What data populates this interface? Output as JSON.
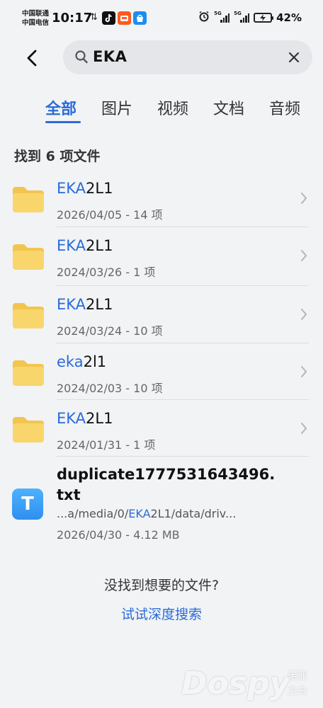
{
  "status_bar": {
    "carrier_1": "中国联通",
    "carrier_2": "中国电信",
    "time": "10:17",
    "data_arrows": "⇅",
    "network_1": "5G",
    "network_2": "5G",
    "battery_percent": "42%"
  },
  "search": {
    "query": "EKA",
    "back_icon": "chevron-left-icon",
    "search_icon": "magnifier-icon",
    "clear_icon": "close-icon"
  },
  "tabs": [
    {
      "label": "全部",
      "active": true
    },
    {
      "label": "图片",
      "active": false
    },
    {
      "label": "视频",
      "active": false
    },
    {
      "label": "文档",
      "active": false
    },
    {
      "label": "音频",
      "active": false
    }
  ],
  "results": {
    "count_label": "找到 6 项文件",
    "folders": [
      {
        "highlight": "EKA",
        "rest": "2L1",
        "meta": "2026/04/05 - 14 项"
      },
      {
        "highlight": "EKA",
        "rest": "2L1",
        "meta": "2024/03/26 - 1 项"
      },
      {
        "highlight": "EKA",
        "rest": "2L1",
        "meta": "2024/03/24 - 10 项"
      },
      {
        "highlight": "eka",
        "rest": "2l1",
        "meta": "2024/02/03 - 10 项"
      },
      {
        "highlight": "EKA",
        "rest": "2L1",
        "meta": "2024/01/31 - 1 项"
      }
    ],
    "file": {
      "icon_letter": "T",
      "name": "duplicate1777531643496.txt",
      "path_prefix": "...a/media/0/",
      "path_highlight": "EKA",
      "path_suffix": "2L1/data/driv...",
      "meta": "2026/04/30 - 4.12 MB"
    }
  },
  "footer": {
    "not_found": "没找到想要的文件?",
    "deep_search": "试试深度搜索"
  },
  "watermark": {
    "brand": "Dospy",
    "sub_1": "诺亚",
    "sub_2": "方舟"
  },
  "colors": {
    "accent": "#2a6bd8",
    "folder": "#f8d46a",
    "background": "#f1f3f5"
  }
}
